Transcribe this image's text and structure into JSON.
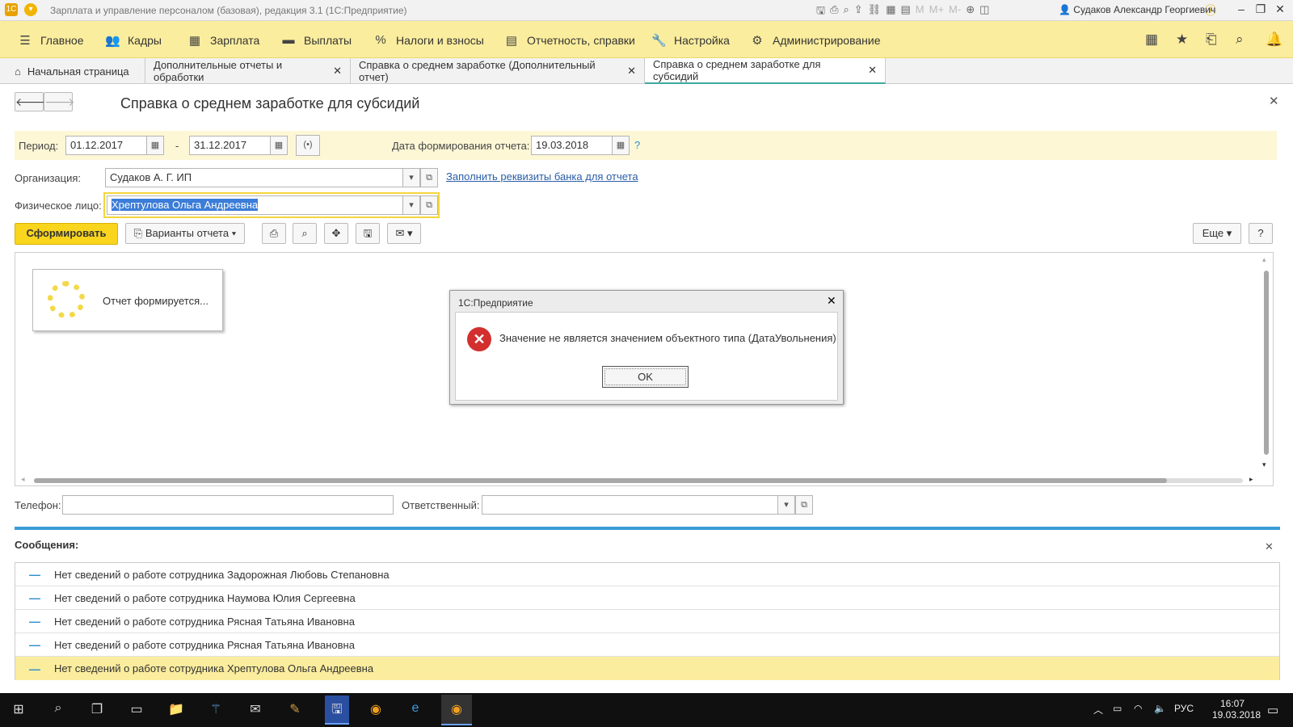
{
  "window": {
    "title": "Зарплата и управление персоналом (базовая), редакция 3.1  (1С:Предприятие)",
    "user": "Судаков Александр Георгиевич"
  },
  "menu": {
    "items": [
      {
        "label": "Главное",
        "icon": "hamburger-icon"
      },
      {
        "label": "Кадры",
        "icon": "people-icon"
      },
      {
        "label": "Зарплата",
        "icon": "calculator-icon"
      },
      {
        "label": "Выплаты",
        "icon": "wallet-icon"
      },
      {
        "label": "Налоги и взносы",
        "icon": "percent-icon"
      },
      {
        "label": "Отчетность, справки",
        "icon": "document-icon"
      },
      {
        "label": "Настройка",
        "icon": "wrench-icon"
      },
      {
        "label": "Администрирование",
        "icon": "gear-icon"
      }
    ]
  },
  "tabs": [
    {
      "label": "Начальная страница"
    },
    {
      "label": "Дополнительные отчеты и обработки"
    },
    {
      "label": "Справка о среднем заработке (Дополнительный отчет)"
    },
    {
      "label": "Справка о среднем заработке для субсидий"
    }
  ],
  "form": {
    "title": "Справка о среднем заработке для субсидий",
    "period_label": "Период:",
    "period_from": "01.12.2017",
    "period_dash": "-",
    "period_to": "31.12.2017",
    "report_date_label": "Дата формирования отчета:",
    "report_date": "19.03.2018",
    "help_mark": "?",
    "org_label": "Организация:",
    "org_value": "Судаков А. Г. ИП",
    "bank_link": "Заполнить реквизиты банка для отчета",
    "person_label": "Физическое лицо:",
    "person_value": "Хрептулова Ольга Андреевна",
    "generate_button": "Сформировать",
    "variants_button": "Варианты отчета",
    "more_button": "Еще",
    "help_button": "?",
    "progress_text": "Отчет формируется...",
    "phone_label": "Телефон:",
    "phone_value": "",
    "responsible_label": "Ответственный:",
    "responsible_value": ""
  },
  "dialog": {
    "title": "1С:Предприятие",
    "message": "Значение не является значением объектного типа (ДатаУвольнения)",
    "ok": "OK"
  },
  "messages": {
    "title": "Сообщения:",
    "items": [
      "Нет сведений о работе сотрудника Задорожная Любовь Степановна",
      "Нет сведений о работе сотрудника Наумова Юлия Сергеевна",
      "Нет сведений о работе сотрудника Рясная Татьяна Ивановна",
      "Нет сведений о работе сотрудника Рясная Татьяна Ивановна",
      "Нет сведений о работе сотрудника Хрептулова Ольга Андреевна"
    ]
  },
  "taskbar": {
    "lang": "РУС",
    "time": "16:07",
    "date": "19.03.2018"
  }
}
